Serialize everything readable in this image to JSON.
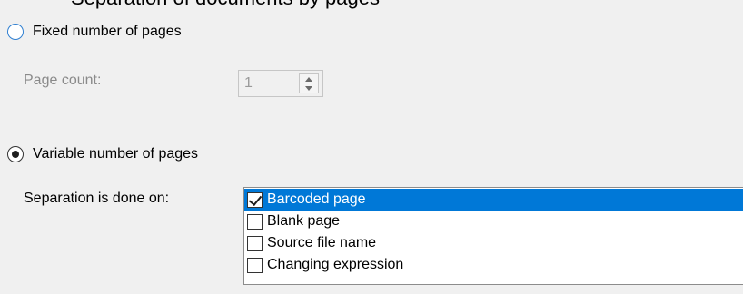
{
  "header": {
    "clipped_caption": "Separation of documents by pages"
  },
  "fixed_option": {
    "label": "Fixed number of pages",
    "checked": false
  },
  "page_count": {
    "label": "Page count:",
    "value": "1"
  },
  "variable_option": {
    "label": "Variable number of pages",
    "checked": true
  },
  "separation": {
    "label": "Separation is done on:",
    "items": [
      {
        "label": "Barcoded page",
        "checked": true,
        "selected": true
      },
      {
        "label": "Blank page",
        "checked": false,
        "selected": false
      },
      {
        "label": "Source file name",
        "checked": false,
        "selected": false
      },
      {
        "label": "Changing expression",
        "checked": false,
        "selected": false
      }
    ]
  },
  "colors": {
    "background": "#f0f0f0",
    "selection": "#0078d7",
    "disabled_text": "#8a8a8a",
    "radio_accent": "#2f7fd1"
  }
}
